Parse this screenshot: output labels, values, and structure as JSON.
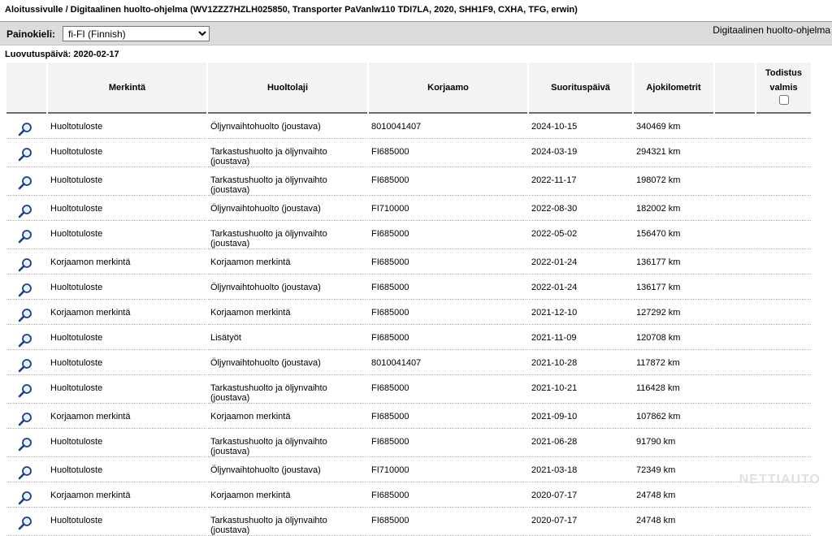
{
  "header": {
    "title": "Aloitussivulle / Digitaalinen huolto-ohjelma (WV1ZZZ7HZLH025850, Transporter PaVanlw110 TDI7LA, 2020, SHH1F9, CXHA, TFG, erwin)"
  },
  "toolbar": {
    "lang_label": "Painokieli:",
    "lang_value": "fi-FI (Finnish)",
    "program_title": "Digitaalinen huolto-ohjelma"
  },
  "delivery": "Luovutuspäivä: 2020-02-17",
  "table": {
    "columns": [
      "",
      "Merkintä",
      "Huoltolaji",
      "Korjaamo",
      "Suorituspäivä",
      "Ajokilometrit",
      "",
      "Todistus valmis"
    ],
    "todistus_line1": "Todistus",
    "todistus_line2": "valmis",
    "rows": [
      {
        "merkinta": "Huoltotuloste",
        "huoltolaji": "Öljynvaihtohuolto (joustava)",
        "korjaamo": "8010041407",
        "pvm": "2024-10-15",
        "km": "340469 km"
      },
      {
        "merkinta": "Huoltotuloste",
        "huoltolaji": "Tarkastushuolto ja öljynvaihto (joustava)",
        "korjaamo": "FI685000",
        "pvm": "2024-03-19",
        "km": "294321 km"
      },
      {
        "merkinta": "Huoltotuloste",
        "huoltolaji": "Tarkastushuolto ja öljynvaihto (joustava)",
        "korjaamo": "FI685000",
        "pvm": "2022-11-17",
        "km": "198072 km"
      },
      {
        "merkinta": "Huoltotuloste",
        "huoltolaji": "Öljynvaihtohuolto (joustava)",
        "korjaamo": "FI710000",
        "pvm": "2022-08-30",
        "km": "182002 km"
      },
      {
        "merkinta": "Huoltotuloste",
        "huoltolaji": "Tarkastushuolto ja öljynvaihto (joustava)",
        "korjaamo": "FI685000",
        "pvm": "2022-05-02",
        "km": "156470 km"
      },
      {
        "merkinta": "Korjaamon merkintä",
        "huoltolaji": "Korjaamon merkintä",
        "korjaamo": "FI685000",
        "pvm": "2022-01-24",
        "km": "136177 km"
      },
      {
        "merkinta": "Huoltotuloste",
        "huoltolaji": "Öljynvaihtohuolto (joustava)",
        "korjaamo": "FI685000",
        "pvm": "2022-01-24",
        "km": "136177 km"
      },
      {
        "merkinta": "Korjaamon merkintä",
        "huoltolaji": "Korjaamon merkintä",
        "korjaamo": "FI685000",
        "pvm": "2021-12-10",
        "km": "127292 km"
      },
      {
        "merkinta": "Huoltotuloste",
        "huoltolaji": "Lisätyöt",
        "korjaamo": "FI685000",
        "pvm": "2021-11-09",
        "km": "120708 km"
      },
      {
        "merkinta": "Huoltotuloste",
        "huoltolaji": "Öljynvaihtohuolto (joustava)",
        "korjaamo": "8010041407",
        "pvm": "2021-10-28",
        "km": "117872 km"
      },
      {
        "merkinta": "Huoltotuloste",
        "huoltolaji": "Tarkastushuolto ja öljynvaihto (joustava)",
        "korjaamo": "FI685000",
        "pvm": "2021-10-21",
        "km": "116428 km"
      },
      {
        "merkinta": "Korjaamon merkintä",
        "huoltolaji": "Korjaamon merkintä",
        "korjaamo": "FI685000",
        "pvm": "2021-09-10",
        "km": "107862 km"
      },
      {
        "merkinta": "Huoltotuloste",
        "huoltolaji": "Tarkastushuolto ja öljynvaihto (joustava)",
        "korjaamo": "FI685000",
        "pvm": "2021-06-28",
        "km": "91790 km"
      },
      {
        "merkinta": "Huoltotuloste",
        "huoltolaji": "Öljynvaihtohuolto (joustava)",
        "korjaamo": "FI710000",
        "pvm": "2021-03-18",
        "km": "72349 km"
      },
      {
        "merkinta": "Korjaamon merkintä",
        "huoltolaji": "Korjaamon merkintä",
        "korjaamo": "FI685000",
        "pvm": "2020-07-17",
        "km": "24748 km"
      },
      {
        "merkinta": "Huoltotuloste",
        "huoltolaji": "Tarkastushuolto ja öljynvaihto (joustava)",
        "korjaamo": "FI685000",
        "pvm": "2020-07-17",
        "km": "24748 km"
      }
    ]
  },
  "row_icon": "magnifier-icon",
  "watermark": "NETTIAUTO"
}
